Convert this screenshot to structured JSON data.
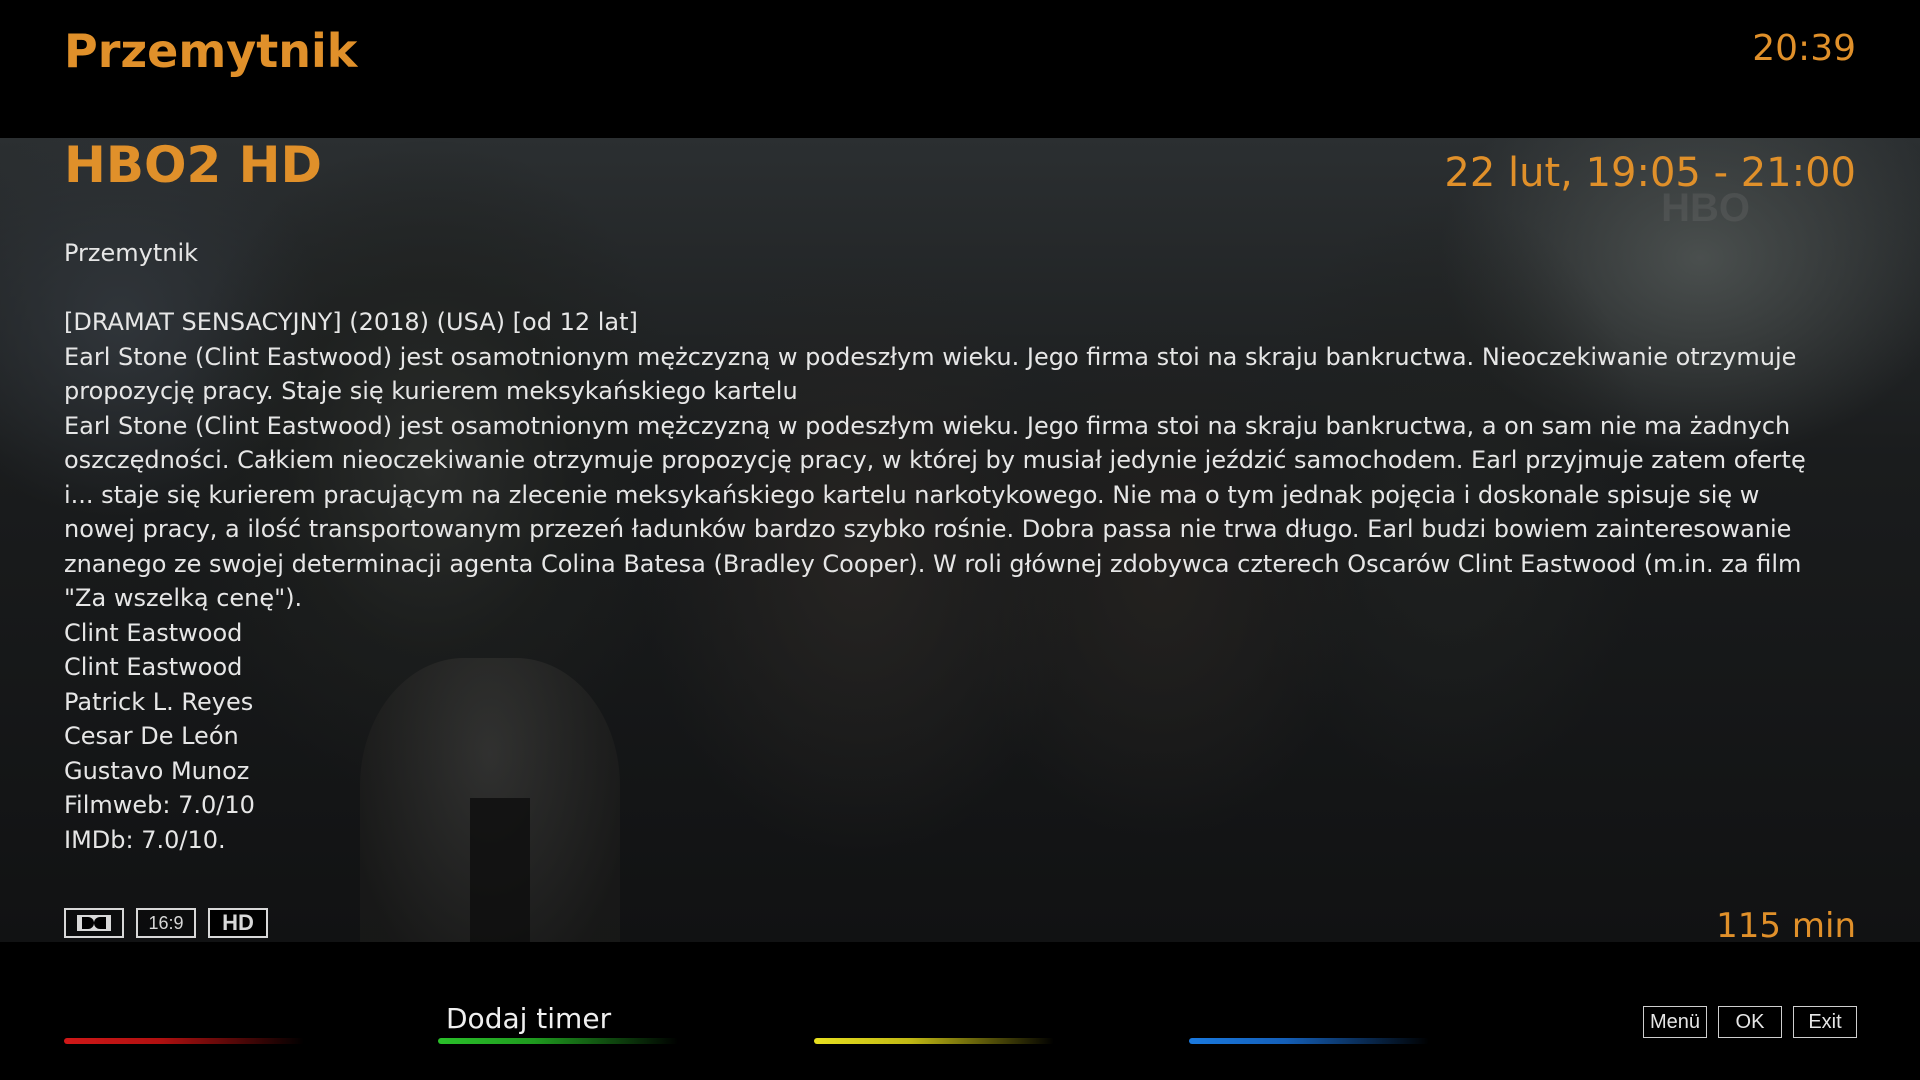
{
  "header": {
    "title": "Przemytnik",
    "clock": "20:39"
  },
  "event": {
    "channel": "HBO2 HD",
    "datetime": "22 lut, 19:05 - 21:00",
    "name": "Przemytnik",
    "genre_line": "[DRAMAT SENSACYJNY]  (2018) (USA) [od 12 lat]",
    "short_description": "Earl Stone (Clint Eastwood) jest osamotnionym mężczyzną w podeszłym wieku. Jego firma stoi na skraju bankructwa. Nieoczekiwanie otrzymuje propozycję pracy. Staje się kurierem meksykańskiego kartelu",
    "long_description": "Earl Stone (Clint Eastwood) jest osamotnionym mężczyzną w podeszłym wieku. Jego firma stoi na skraju bankructwa, a on sam nie ma żadnych oszczędności. Całkiem nieoczekiwanie otrzymuje propozycję pracy, w której by musiał jedynie jeździć samochodem. Earl przyjmuje zatem ofertę i... staje się kurierem pracującym na zlecenie meksykańskiego kartelu narkotykowego. Nie ma o tym jednak pojęcia i doskonale spisuje się w nowej pracy, a ilość transportowanym przezeń ładunków bardzo szybko rośnie. Dobra passa nie trwa długo. Earl budzi bowiem zainteresowanie znanego ze swojej determinacji agenta Colina Batesa (Bradley Cooper). W roli głównej zdobywca czterech Oscarów Clint Eastwood (m.in. za film \"Za wszelką cenę\").",
    "credits": [
      "Clint Eastwood",
      "Clint Eastwood",
      "Patrick L. Reyes",
      "Cesar De León",
      "Gustavo Munoz"
    ],
    "ratings": {
      "filmweb": "Filmweb: 7.0/10",
      "imdb": "IMDb: 7.0/10."
    },
    "duration": "115 min"
  },
  "badges": {
    "dolby": "dolby-icon",
    "aspect": "16:9",
    "hd": "HD"
  },
  "background": {
    "watermark": "HBO"
  },
  "footer": {
    "green_label": "Dodaj timer",
    "buttons": {
      "menu": "Menü",
      "ok": "OK",
      "exit": "Exit"
    },
    "colors": {
      "red": "#d01818",
      "green": "#2ac02a",
      "yellow": "#e8e020",
      "blue": "#1a7ae0"
    }
  },
  "theme": {
    "accent": "#e0902a",
    "text": "#e6e6e6"
  }
}
